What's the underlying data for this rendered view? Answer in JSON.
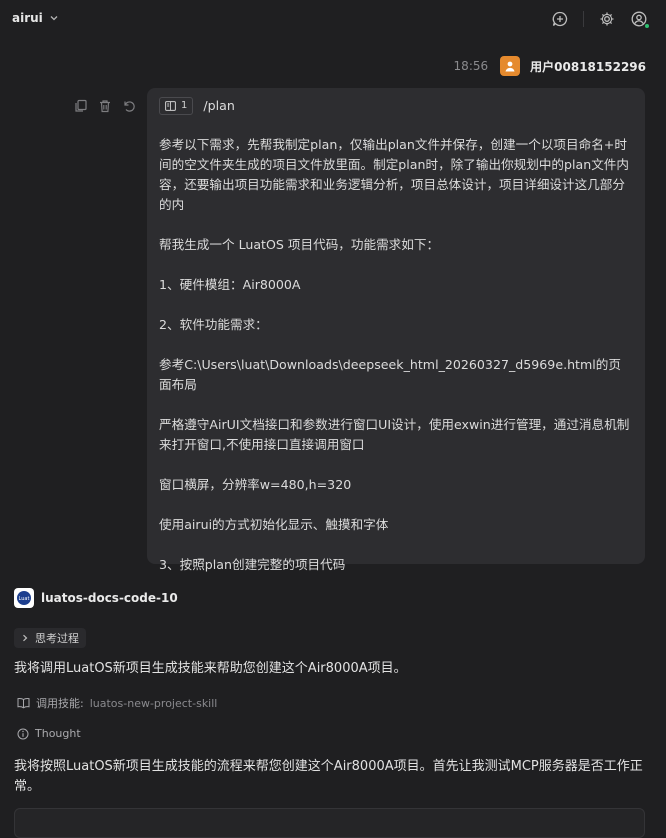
{
  "header": {
    "app_name": "airui"
  },
  "user_message": {
    "time": "18:56",
    "username": "用户00818152296",
    "chip_count": "1",
    "command": "/plan",
    "paragraphs": [
      "参考以下需求，先帮我制定plan，仅输出plan文件并保存，创建一个以项目命名+时间的空文件夹生成的项目文件放里面。制定plan时，除了输出你规划中的plan文件内容，还要输出项目功能需求和业务逻辑分析，项目总体设计，项目详细设计这几部分的内",
      "帮我生成一个 LuatOS 项目代码，功能需求如下：",
      "1、硬件模组：Air8000A",
      "2、软件功能需求：",
      "参考C:\\Users\\luat\\Downloads\\deepseek_html_20260327_d5969e.html的页面布局",
      "严格遵守AirUI文档接口和参数进行窗口UI设计，使用exwin进行管理，通过消息机制来打开窗口,不使用接口直接调用窗口",
      "窗口横屏，分辨率w=480,h=320",
      "使用airui的方式初始化显示、触摸和字体",
      "3、按照plan创建完整的项目代码"
    ]
  },
  "assistant": {
    "name": "luatos-docs-code-10",
    "avatar_text": "Luat",
    "thinking_label": "思考过程",
    "line1": "我将调用LuatOS新项目生成技能来帮助您创建这个Air8000A项目。",
    "skill_prefix": "调用技能:",
    "skill_name": "luatos-new-project-skill",
    "thought_label": "Thought",
    "line2": "我将按照LuatOS新项目生成技能的流程来帮您创建这个Air8000A项目。首先让我测试MCP服务器是否工作正常。"
  }
}
